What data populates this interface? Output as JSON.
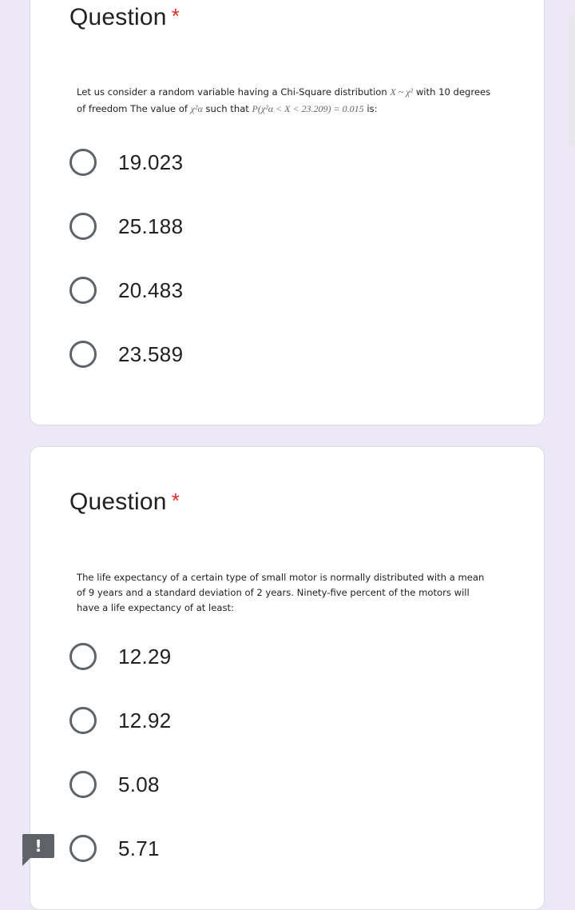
{
  "questions": [
    {
      "title": "Question",
      "required_marker": "*",
      "text_parts": {
        "p1": "Let us consider a random variable having a Chi-Square distribution",
        "m1": "X ~ χ²",
        "p2": "with 10 degrees of freedom The value of",
        "m2": "χ²α",
        "p3": "such that",
        "m3": "P(χ²α < X < 23.209) = 0.015",
        "p4": "is:"
      },
      "options": [
        "19.023",
        "25.188",
        "20.483",
        "23.589"
      ]
    },
    {
      "title": "Question",
      "required_marker": "*",
      "text": "The life expectancy of a certain type of small motor is normally distributed with a mean of 9 years and a standard deviation of 2 years. Ninety-five percent of the motors will have a life expectancy of at least:",
      "options": [
        "12.29",
        "12.92",
        "5.08",
        "5.71"
      ]
    }
  ],
  "feedback": {
    "icon": "exclamation-icon",
    "symbol": "!"
  },
  "colors": {
    "background": "#ece8f7",
    "required": "#d93025",
    "radio_border": "#5f6368"
  }
}
